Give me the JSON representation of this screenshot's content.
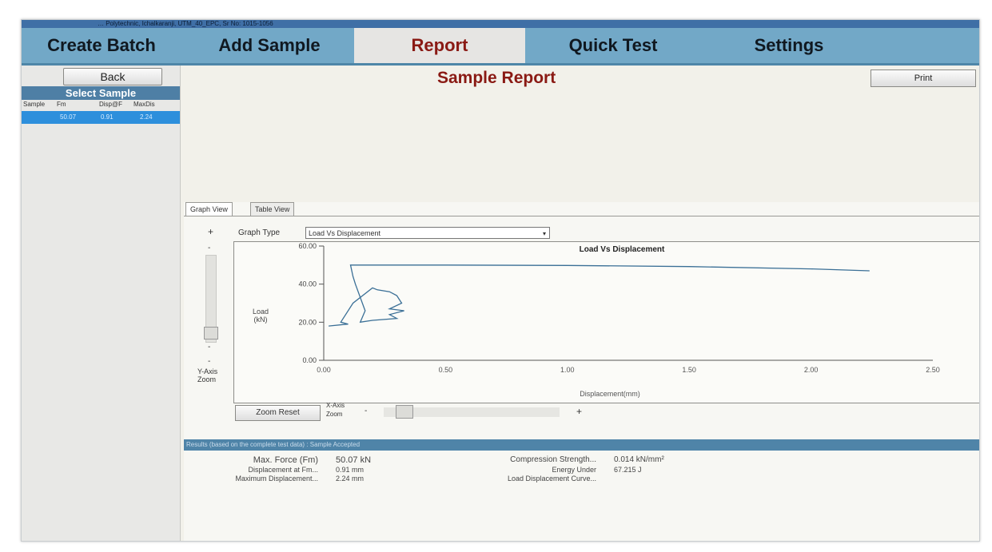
{
  "window": {
    "title": "… Polytechnic, Ichalkaranji, UTM_40_EPC, Sr No: 1015-1056"
  },
  "nav": {
    "create_batch": "Create Batch",
    "add_sample": "Add Sample",
    "report": "Report",
    "quick_test": "Quick Test",
    "settings": "Settings",
    "active": "report"
  },
  "sidebar": {
    "back": "Back",
    "select_sample": "Select Sample",
    "columns": [
      "Sample",
      "Fm",
      "Disp@F",
      "MaxDis"
    ],
    "rows": [
      {
        "sample": "",
        "fm": "50.07",
        "disp": "0.91",
        "maxdisp": "2.24"
      }
    ]
  },
  "header": {
    "title": "Sample Report",
    "print": "Print"
  },
  "tabs": {
    "graph_view": "Graph View",
    "table_view": "Table View"
  },
  "graph": {
    "graph_type_label": "Graph Type",
    "graph_type_value": "Load Vs Displacement",
    "y_zoom_label": "Y-Axis Zoom",
    "x_zoom_label": "X-Axis Zoom",
    "zoom_reset": "Zoom Reset",
    "plus": "+",
    "minus": "-"
  },
  "chart_data": {
    "type": "line",
    "title": "Load Vs Displacement",
    "xlabel": "Displacement(mm)",
    "ylabel": "Load (kN)",
    "xlim": [
      0,
      2.5
    ],
    "ylim": [
      0,
      60
    ],
    "xticks": [
      "0.00",
      "0.50",
      "1.00",
      "1.50",
      "2.00",
      "2.50"
    ],
    "yticks": [
      "0.00",
      "20.00",
      "40.00",
      "60.00"
    ],
    "series": [
      {
        "x": [
          0.02,
          0.1,
          0.07,
          0.12,
          0.2,
          0.22,
          0.27,
          0.3,
          0.32,
          0.27,
          0.33,
          0.27,
          0.3,
          0.2,
          0.15,
          0.17,
          0.13,
          0.12,
          0.11,
          0.5,
          1.0,
          1.5,
          2.0,
          2.24
        ],
        "y": [
          18,
          19,
          20,
          30,
          38,
          37,
          36,
          34,
          30,
          27,
          26,
          24,
          22,
          21,
          20,
          26,
          40,
          44,
          50,
          50,
          49.8,
          49.2,
          48,
          47
        ],
        "color": "#3a6f96"
      }
    ]
  },
  "results": {
    "bar_text": "Results (based on the complete test data) : Sample Accepted",
    "max_force_label": "Max. Force (Fm)",
    "max_force_value": "50.07 kN",
    "disp_at_fm_label": "Displacement at Fm...",
    "disp_at_fm_value": "0.91 mm",
    "max_disp_label": "Maximum Displacement...",
    "max_disp_value": "2.24 mm",
    "comp_strength_label": "Compression Strength...",
    "comp_strength_value": "0.014 kN/mm²",
    "energy_label": "Energy Under",
    "energy_value": "67.215 J",
    "energy_label2": "Load Displacement Curve..."
  }
}
